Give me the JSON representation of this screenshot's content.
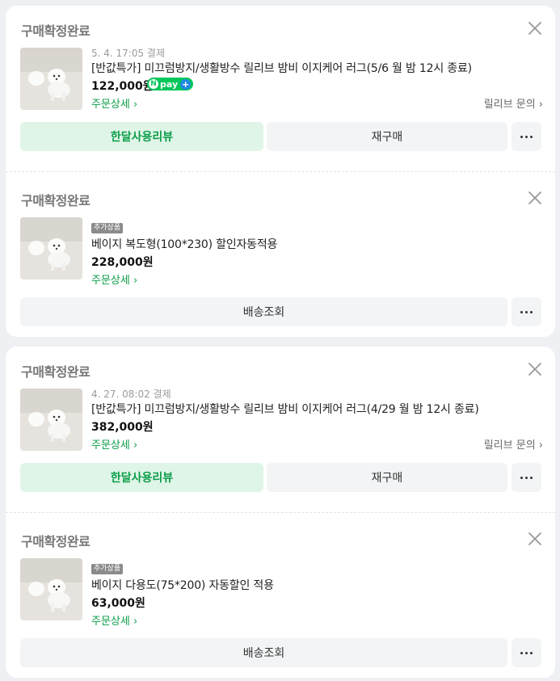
{
  "orders": [
    {
      "status": "구매확정완료",
      "date": "5. 4. 17:05 결제",
      "product_name": "[반값특가] 미끄럼방지/생활방수 릴리브 밤비 이지케어 러그(5/6 월 밤 12시 종료)",
      "price": "122,000원",
      "npay_text": "pay",
      "detail_link": "주문상세",
      "seller_link": "릴리브 문의",
      "review_button": "한달사용리뷰",
      "rebuy_button": "재구매",
      "add_item": {
        "tag": "추가상품",
        "product_name": "베이지 복도형(100*230) 할인자동적용",
        "price": "228,000원",
        "detail_link": "주문상세",
        "status": "구매확정완료",
        "ship_button": "배송조회"
      }
    },
    {
      "status": "구매확정완료",
      "date": "4. 27. 08:02 결제",
      "product_name": "[반값특가] 미끄럼방지/생활방수 릴리브 밤비 이지케어 러그(4/29 월 밤 12시 종료)",
      "price": "382,000원",
      "detail_link": "주문상세",
      "seller_link": "릴리브 문의",
      "review_button": "한달사용리뷰",
      "rebuy_button": "재구매",
      "add_item": {
        "tag": "추가상품",
        "product_name": "베이지 다용도(75*200) 자동할인 적용",
        "price": "63,000원",
        "detail_link": "주문상세",
        "status": "구매확정완료",
        "ship_button": "배송조회"
      }
    }
  ],
  "icons": {
    "close": "close-icon",
    "more": "more-icon",
    "chevron": "chevron-right-icon",
    "npay": "npay-plus-icon"
  },
  "colors": {
    "accent_green": "#0b9d48",
    "review_bg": "#dff5e8",
    "npay_green": "#03c75a"
  }
}
